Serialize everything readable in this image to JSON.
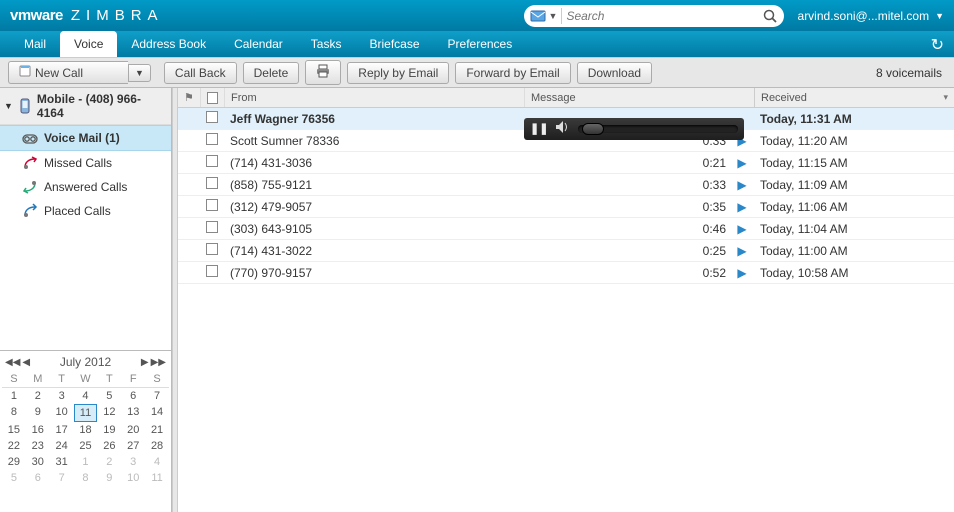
{
  "brand": {
    "vmware": "vmware",
    "zimbra": "ZIMBRA"
  },
  "search": {
    "placeholder": "Search"
  },
  "user": {
    "label": "arvind.soni@...mitel.com"
  },
  "tabs": {
    "mail": "Mail",
    "voice": "Voice",
    "address": "Address Book",
    "calendar": "Calendar",
    "tasks": "Tasks",
    "briefcase": "Briefcase",
    "preferences": "Preferences"
  },
  "toolbar": {
    "new_call": "New Call",
    "call_back": "Call Back",
    "delete": "Delete",
    "reply_email": "Reply by Email",
    "forward_email": "Forward by Email",
    "download": "Download"
  },
  "status": {
    "voicemails": "8 voicemails"
  },
  "sidebar": {
    "root": "Mobile - (408) 966-4164",
    "voice_mail": "Voice Mail (1)",
    "missed": "Missed Calls",
    "answered": "Answered Calls",
    "placed": "Placed Calls"
  },
  "calendar": {
    "title": "July 2012",
    "wkdays": [
      "S",
      "M",
      "T",
      "W",
      "T",
      "F",
      "S"
    ],
    "weeks": [
      [
        {
          "d": "1"
        },
        {
          "d": "2"
        },
        {
          "d": "3"
        },
        {
          "d": "4"
        },
        {
          "d": "5"
        },
        {
          "d": "6"
        },
        {
          "d": "7"
        }
      ],
      [
        {
          "d": "8"
        },
        {
          "d": "9"
        },
        {
          "d": "10"
        },
        {
          "d": "11",
          "today": true
        },
        {
          "d": "12"
        },
        {
          "d": "13"
        },
        {
          "d": "14"
        }
      ],
      [
        {
          "d": "15"
        },
        {
          "d": "16"
        },
        {
          "d": "17"
        },
        {
          "d": "18"
        },
        {
          "d": "19"
        },
        {
          "d": "20"
        },
        {
          "d": "21"
        }
      ],
      [
        {
          "d": "22"
        },
        {
          "d": "23"
        },
        {
          "d": "24"
        },
        {
          "d": "25"
        },
        {
          "d": "26"
        },
        {
          "d": "27"
        },
        {
          "d": "28"
        }
      ],
      [
        {
          "d": "29"
        },
        {
          "d": "30"
        },
        {
          "d": "31"
        },
        {
          "d": "1",
          "other": true
        },
        {
          "d": "2",
          "other": true
        },
        {
          "d": "3",
          "other": true
        },
        {
          "d": "4",
          "other": true
        }
      ],
      [
        {
          "d": "5",
          "other": true
        },
        {
          "d": "6",
          "other": true
        },
        {
          "d": "7",
          "other": true
        },
        {
          "d": "8",
          "other": true
        },
        {
          "d": "9",
          "other": true
        },
        {
          "d": "10",
          "other": true
        },
        {
          "d": "11",
          "other": true
        }
      ]
    ]
  },
  "list": {
    "headers": {
      "from": "From",
      "message": "Message",
      "received": "Received"
    },
    "rows": [
      {
        "from": "Jeff Wagner  76356",
        "duration": "",
        "received": "Today, 11:31 AM",
        "selected": true,
        "player": true
      },
      {
        "from": "Scott Sumner  78336",
        "duration": "0:33",
        "received": "Today, 11:20 AM"
      },
      {
        "from": "(714) 431-3036",
        "duration": "0:21",
        "received": "Today, 11:15 AM"
      },
      {
        "from": "(858) 755-9121",
        "duration": "0:33",
        "received": "Today, 11:09 AM"
      },
      {
        "from": "(312) 479-9057",
        "duration": "0:35",
        "received": "Today, 11:06 AM"
      },
      {
        "from": "(303) 643-9105",
        "duration": "0:46",
        "received": "Today, 11:04 AM"
      },
      {
        "from": "(714) 431-3022",
        "duration": "0:25",
        "received": "Today, 11:00 AM"
      },
      {
        "from": "(770) 970-9157",
        "duration": "0:52",
        "received": "Today, 10:58 AM"
      }
    ]
  }
}
